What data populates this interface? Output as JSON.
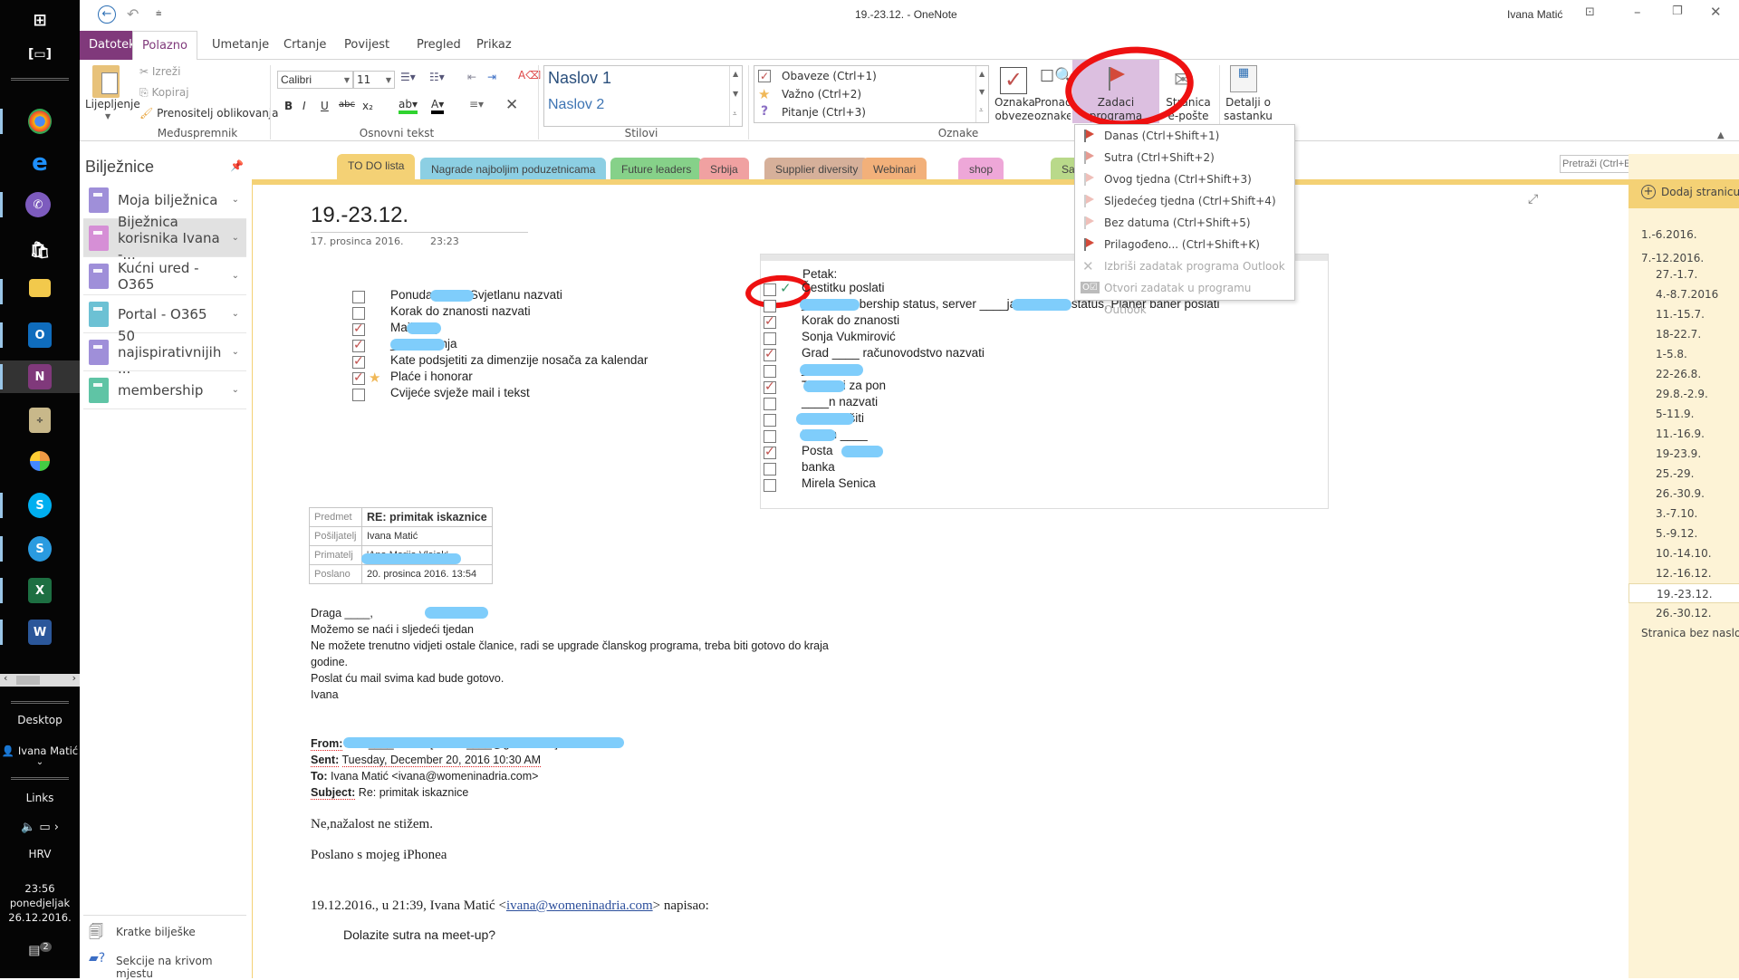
{
  "taskbar": {
    "apps": [
      "start",
      "task-view",
      "chrome",
      "edge",
      "viber",
      "store",
      "file-explorer",
      "outlook",
      "onenote",
      "calculator",
      "paint",
      "skype",
      "skype-business",
      "excel",
      "word"
    ],
    "desktop_label": "Desktop",
    "user_label": "Ivana Matić",
    "links_label": "Links",
    "language": "HRV",
    "time": "23:56",
    "day": "ponedjeljak",
    "date": "26.12.2016.",
    "notifications_count": "2"
  },
  "titlebar": {
    "title": "19.-23.12.  -  OneNote",
    "user": "Ivana Matić"
  },
  "ribbon_tabs": [
    "Datoteka",
    "Polazno",
    "Umetanje",
    "Crtanje",
    "Povijest",
    "Pregled",
    "Prikaz"
  ],
  "ribbon": {
    "clipboard": {
      "paste": "Lijepljenje",
      "cut": "Izreži",
      "copy": "Kopiraj",
      "format_painter": "Prenositelj oblikovanja",
      "label": "Međuspremnik"
    },
    "basic_text": {
      "font": "Calibri",
      "size": "11",
      "bold": "B",
      "italic": "I",
      "underline": "U",
      "strike": "abc",
      "subscript": "x₂",
      "label": "Osnovni tekst"
    },
    "styles": {
      "heading1": "Naslov 1",
      "heading2": "Naslov 2",
      "label": "Stilovi"
    },
    "tags": {
      "items": [
        "Obaveze (Ctrl+1)",
        "Važno (Ctrl+2)",
        "Pitanje (Ctrl+3)"
      ],
      "todo_tag": "Oznaka obveze",
      "find_tags": "Pronađi oznake",
      "outlook_tasks": "Zadaci programa Outlook",
      "label": "Oznake"
    },
    "email": {
      "email_page": "Stranica e-pošte"
    },
    "meetings": {
      "meeting_details": "Detalji o sastanku"
    }
  },
  "outlook_menu": [
    {
      "label": "Danas (Ctrl+Shift+1)",
      "enabled": true
    },
    {
      "label": "Sutra  (Ctrl+Shift+2)",
      "enabled": true
    },
    {
      "label": "Ovog tjedna (Ctrl+Shift+3)",
      "enabled": true
    },
    {
      "label": "Sljedećeg tjedna  (Ctrl+Shift+4)",
      "enabled": true
    },
    {
      "label": "Bez datuma (Ctrl+Shift+5)",
      "enabled": true
    },
    {
      "label": "Prilagođeno...  (Ctrl+Shift+K)",
      "enabled": true
    },
    {
      "label": "Izbriši zadatak programa Outlook",
      "enabled": false
    },
    {
      "label": "Otvori zadatak u programu Outlook",
      "enabled": false
    }
  ],
  "notebooks": {
    "title": "Bilježnice",
    "items": [
      {
        "label": "Moja bilježnica",
        "color": "#9f8fd9"
      },
      {
        "label": "Biježnica korisnika Ivana -...",
        "color": "#d68fd6",
        "selected": true
      },
      {
        "label": "Kućni ured - O365",
        "color": "#9f8fd9"
      },
      {
        "label": "Portal - O365",
        "color": "#6cc1d4"
      },
      {
        "label": "50 najispirativnijih ...",
        "color": "#9f8fd9"
      },
      {
        "label": "membership",
        "color": "#5fc4a5"
      }
    ],
    "quick_notes": "Kratke bilješke",
    "misplaced": "Sekcije na krivom mjestu"
  },
  "sections": [
    {
      "label": "TO DO lista",
      "color": "#f4d175",
      "active": true
    },
    {
      "label": "Nagrade najboljim poduzetnicama",
      "color": "#8ccfe3"
    },
    {
      "label": "Future leaders",
      "color": "#86d189"
    },
    {
      "label": "Srbija",
      "color": "#f0a1a1"
    },
    {
      "label": "Supplier diversity",
      "color": "#d6b09a"
    },
    {
      "label": "Webinari",
      "color": "#f2b07a"
    },
    {
      "label": "shop",
      "color": "#eea7d8"
    },
    {
      "label": "Sajmovi",
      "color": "#b9d98a"
    },
    {
      "label": "+",
      "color": "#ffffff"
    }
  ],
  "search": {
    "placeholder": "Pretraži (Ctrl+E)"
  },
  "page": {
    "title": "19.-23.12.",
    "date": "17. prosinca 2016.",
    "time": "23:23",
    "todo_left": [
      {
        "text": "Ponuda ____, Svjetlanu nazvati",
        "checked": false
      },
      {
        "text": "Korak do znanosti nazvati",
        "checked": false
      },
      {
        "text": "Mail ___",
        "checked": true
      },
      {
        "text": "____ pitanja",
        "checked": true
      },
      {
        "text": "Kate podsjetiti za dimenzije nosača za kalendar",
        "checked": true
      },
      {
        "text": "Plaće i honorar",
        "checked": true,
        "star": true
      },
      {
        "text": "Cvijeće svježe mail i tekst",
        "checked": false
      }
    ],
    "friday_title": "Petak:",
    "todo_right": [
      {
        "text": "Čestitku poslati",
        "checked": false,
        "outlook": true
      },
      {
        "text": "____ membership status, server ____ja, nagrade status, Planer baner poslati",
        "checked": false
      },
      {
        "text": "Korak do znanosti",
        "checked": true
      },
      {
        "text": "Sonja Vukmirović",
        "checked": false
      },
      {
        "text": "Grad ____ računovodstvo nazvati",
        "checked": true
      },
      {
        "text": "____",
        "checked": false
      },
      {
        "text": "Tekstovi za pon",
        "checked": true
      },
      {
        "text": "____n nazvati",
        "checked": false
      },
      {
        "text": "___ dovršiti",
        "checked": false
      },
      {
        "text": "Račun ____",
        "checked": false
      },
      {
        "text": "Posta",
        "checked": true
      },
      {
        "text": "banka",
        "checked": false
      },
      {
        "text": "Mirela Senica",
        "checked": false
      }
    ],
    "email_meta": [
      {
        "key": "Predmet",
        "value": "RE: primitak iskaznice"
      },
      {
        "key": "Pošiljatelj",
        "value": "Ivana Matić"
      },
      {
        "key": "Primatelj",
        "value": "'Ana Marija Vlajak'"
      },
      {
        "key": "Poslano",
        "value": "20. prosinca 2016. 13:54"
      }
    ],
    "email_body": [
      "Draga ____,",
      "Možemo se naći i sljedeći tjedan",
      "Ne možete trenutno vidjeti ostale članice, radi se upgrade članskog programa, treba biti gotovo do kraja",
      "godine.",
      "Poslat ću mail svima kad bude gotovo.",
      "Ivana"
    ],
    "quoted": {
      "from_label": "From:",
      "from_value": "Ana ____ Vidick [mailto:____@gmail.com]",
      "sent_label": "Sent:",
      "sent_value": "Tuesday, December 20, 2016 10:30 AM",
      "to_label": "To:",
      "to_value": "Ivana Matić <ivana@womeninadria.com>",
      "subject_label": "Subject:",
      "subject_value": "Re: primitak iskaznice",
      "line1": "Ne,nažalost ne stižem.",
      "line2": "Poslano s mojeg iPhonea",
      "reply_prefix": "19.12.2016., u 21:39, Ivana Matić <",
      "reply_link": "ivana@womeninadria.com",
      "reply_suffix": "> napisao:",
      "question": "Dolazite sutra na meet-up?"
    }
  },
  "pages_pane": {
    "add_page": "Dodaj stranicu",
    "items": [
      {
        "label": "1.-6.2016.",
        "level": 0,
        "collapse": true
      },
      {
        "label": "7.-12.2016.",
        "level": 0
      },
      {
        "label": "27.-1.7.",
        "level": 1
      },
      {
        "label": "4.-8.7.2016",
        "level": 1
      },
      {
        "label": "11.-15.7.",
        "level": 1
      },
      {
        "label": "18-22.7.",
        "level": 1
      },
      {
        "label": "1-5.8.",
        "level": 1
      },
      {
        "label": "22-26.8.",
        "level": 1
      },
      {
        "label": "29.8.-2.9.",
        "level": 1
      },
      {
        "label": "5-11.9.",
        "level": 1
      },
      {
        "label": "11.-16.9.",
        "level": 1
      },
      {
        "label": "19-23.9.",
        "level": 1
      },
      {
        "label": "25.-29.",
        "level": 1
      },
      {
        "label": "26.-30.9.",
        "level": 1
      },
      {
        "label": "3.-7.10.",
        "level": 1
      },
      {
        "label": "5.-9.12.",
        "level": 1
      },
      {
        "label": "10.-14.10.",
        "level": 1
      },
      {
        "label": "12.-16.12.",
        "level": 1
      },
      {
        "label": "19.-23.12.",
        "level": 1,
        "selected": true
      },
      {
        "label": "26.-30.12.",
        "level": 1
      },
      {
        "label": "Stranica bez naslova",
        "level": 0
      }
    ]
  }
}
